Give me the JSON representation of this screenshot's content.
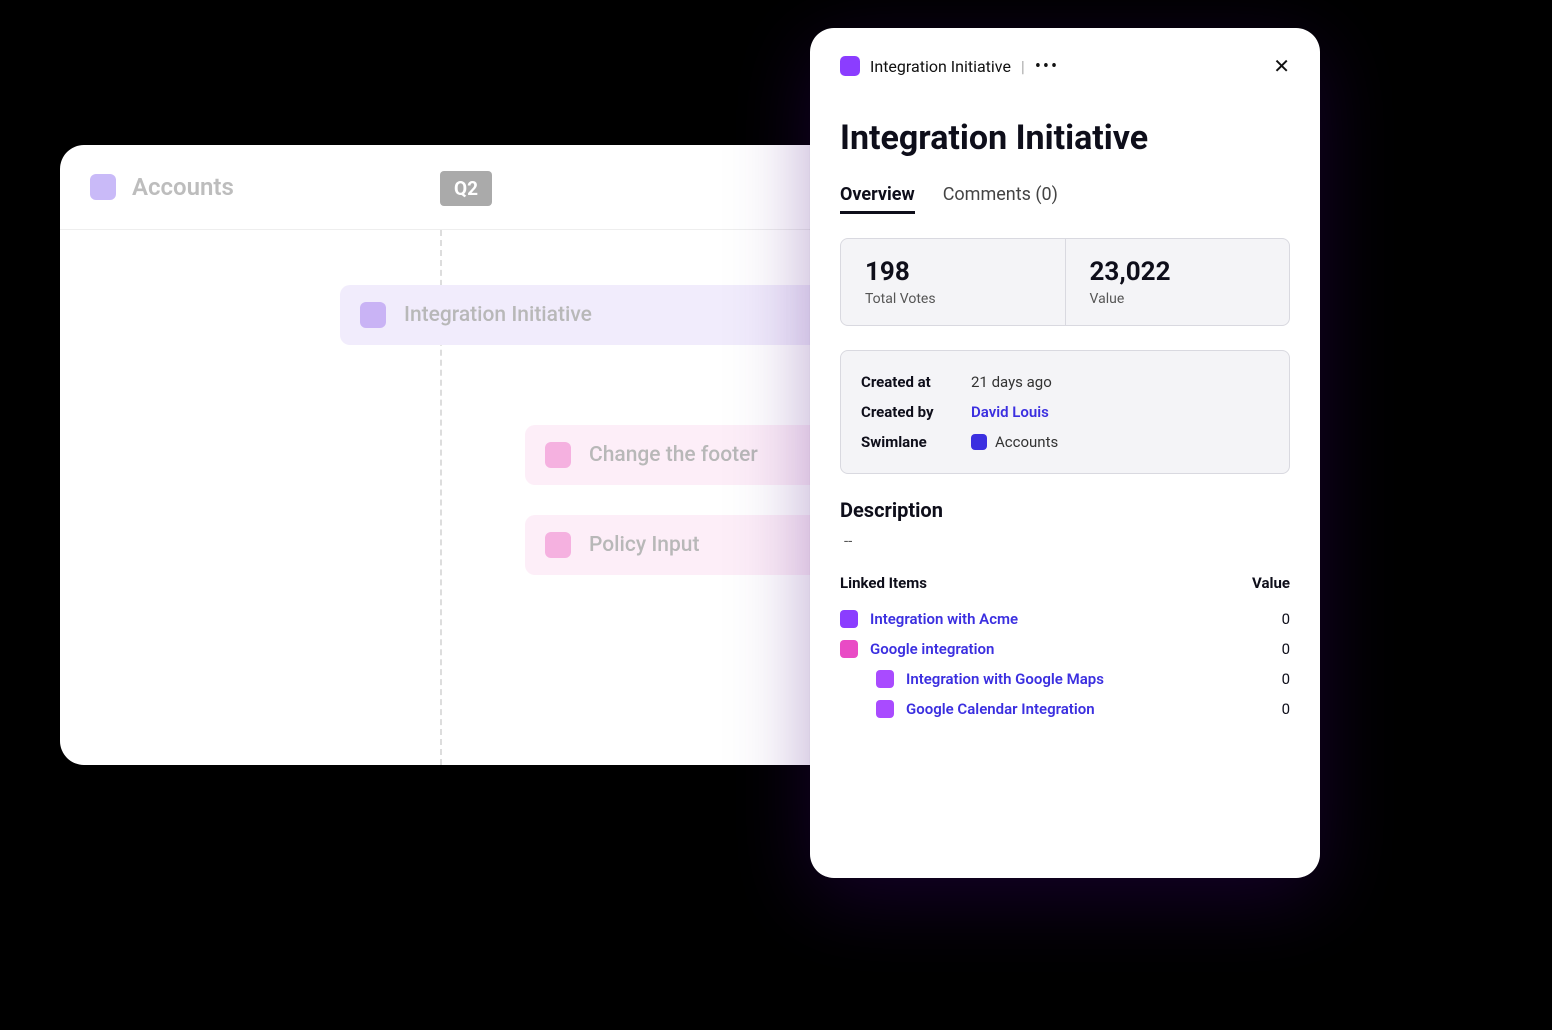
{
  "board": {
    "swimlane_title": "Accounts",
    "quarter": "Q2",
    "cards": [
      {
        "label": "Integration Initiative",
        "color": "purple",
        "has_menu": true
      },
      {
        "label": "Change the footer",
        "color": "pink",
        "has_menu": false
      },
      {
        "label": "Policy Input",
        "color": "pink",
        "has_menu": false
      }
    ]
  },
  "panel": {
    "breadcrumb": "Integration Initiative",
    "title": "Integration Initiative",
    "tabs": {
      "overview": "Overview",
      "comments": "Comments (0)"
    },
    "stats": {
      "votes_value": "198",
      "votes_label": "Total Votes",
      "value_value": "23,022",
      "value_label": "Value"
    },
    "meta": {
      "created_at_label": "Created at",
      "created_at_value": "21 days ago",
      "created_by_label": "Created by",
      "created_by_value": "David Louis",
      "swimlane_label": "Swimlane",
      "swimlane_value": "Accounts"
    },
    "description_heading": "Description",
    "description_body": "--",
    "linked": {
      "header_items": "Linked Items",
      "header_value": "Value",
      "items": [
        {
          "name": "Integration with Acme",
          "color": "purple",
          "value": "0",
          "indent": false
        },
        {
          "name": "Google integration",
          "color": "pink",
          "value": "0",
          "indent": false
        },
        {
          "name": "Integration with Google Maps",
          "color": "violet",
          "value": "0",
          "indent": true
        },
        {
          "name": "Google Calendar Integration",
          "color": "violet",
          "value": "0",
          "indent": true
        }
      ]
    }
  }
}
